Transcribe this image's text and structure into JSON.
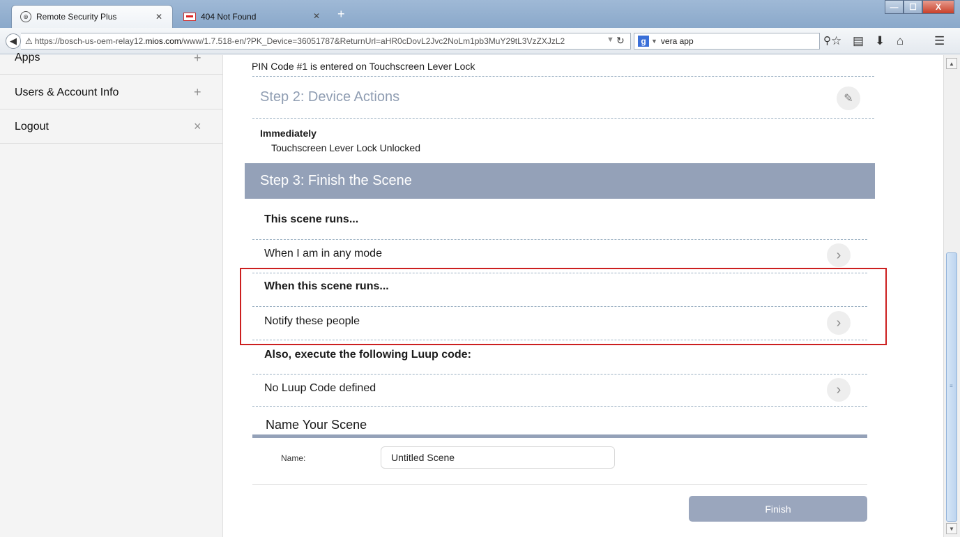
{
  "browser": {
    "tabs": [
      {
        "title": "Remote Security Plus",
        "active": true
      },
      {
        "title": "404 Not Found",
        "active": false
      }
    ],
    "new_tab": "+",
    "window_controls": {
      "minimize": "—",
      "maximize": "☐",
      "close": "X"
    },
    "url": {
      "prefix": "https://bosch-us-oem-relay12.",
      "domain": "mios.com",
      "suffix": "/www/1.7.518-en/?PK_Device=36051787&ReturnUrl=aHR0cDovL2Jvc2NoLm1pb3MuY29tL3VzZXJzL2"
    },
    "search": {
      "engine": "g",
      "value": "vera app"
    }
  },
  "sidebar": {
    "items": [
      {
        "label": "Apps",
        "symbol": "+"
      },
      {
        "label": "Users & Account Info",
        "symbol": "+"
      },
      {
        "label": "Logout",
        "symbol": "×"
      }
    ]
  },
  "trigger": {
    "text": "PIN Code #1 is entered on Touchscreen Lever Lock"
  },
  "step2": {
    "title": "Step 2: Device Actions",
    "timing": "Immediately",
    "action": "Touchscreen Lever Lock Unlocked"
  },
  "step3": {
    "title": "Step 3: Finish the Scene",
    "runs_heading": "This scene runs...",
    "mode_row": "When I am in any mode",
    "when_heading": "When this scene runs...",
    "notify_row": "Notify these people",
    "luup_heading": "Also, execute the following Luup code:",
    "luup_row": "No Luup Code defined"
  },
  "name_section": {
    "title": "Name Your Scene",
    "label": "Name:",
    "value": "Untitled Scene"
  },
  "finish_button": "Finish",
  "colors": {
    "step_header": "#94a1b8",
    "highlight_border": "#cc1f1f",
    "finish_button": "#9aa6bd"
  }
}
